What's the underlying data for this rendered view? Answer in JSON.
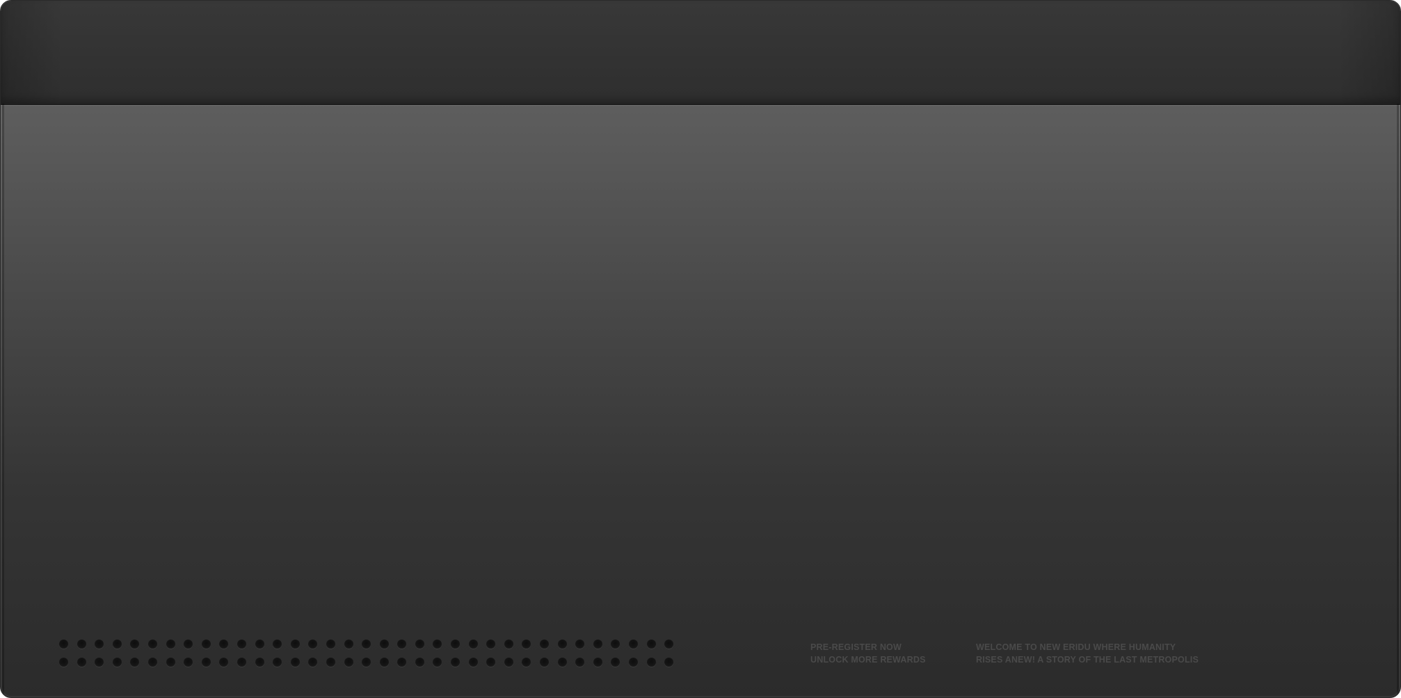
{
  "device": {
    "speaker_grille": {
      "rows": 2,
      "columns": 35
    }
  },
  "promo_left": {
    "line1": "PRE-REGISTER NOW",
    "line2": "UNLOCK MORE REWARDS"
  },
  "promo_right": {
    "line1": "WELCOME TO NEW ERIDU WHERE HUMANITY",
    "line2": "RISES ANEW! A STORY OF THE LAST METROPOLIS"
  },
  "colors": {
    "body_top": "#686868",
    "body_bottom": "#2b2b2b",
    "top_bar": "#333333",
    "text": "#4a4a4a"
  }
}
